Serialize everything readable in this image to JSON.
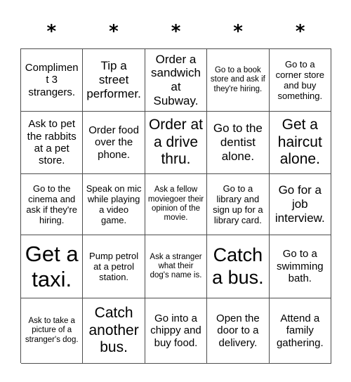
{
  "card": {
    "title": "Bingo Card",
    "columns": 5,
    "rows": 5,
    "header": {
      "icon": "asterisk-icon",
      "labels": [
        "*",
        "*",
        "*",
        "*",
        "*"
      ]
    },
    "colors": {
      "border": "#4d4d4d",
      "text": "#000000",
      "background": "#ffffff"
    },
    "cells": [
      {
        "text": "Compliment 3 strangers.",
        "size": "fs-m"
      },
      {
        "text": "Tip a street performer.",
        "size": "fs-l"
      },
      {
        "text": "Order a sandwich at Subway.",
        "size": "fs-l"
      },
      {
        "text": "Go to a book store and ask if they're hiring.",
        "size": "fs-xs"
      },
      {
        "text": "Go to a corner store and buy something.",
        "size": "fs-s"
      },
      {
        "text": "Ask to pet the rabbits at a pet store.",
        "size": "fs-m"
      },
      {
        "text": "Order food over the phone.",
        "size": "fs-m"
      },
      {
        "text": "Order at a drive thru.",
        "size": "fs-xl"
      },
      {
        "text": "Go to the dentist alone.",
        "size": "fs-l"
      },
      {
        "text": "Get a haircut alone.",
        "size": "fs-xl"
      },
      {
        "text": "Go to the cinema and ask if they're hiring.",
        "size": "fs-s"
      },
      {
        "text": "Speak on mic while playing a video game.",
        "size": "fs-s"
      },
      {
        "text": "Ask a fellow moviegoer their opinion of the movie.",
        "size": "fs-xs"
      },
      {
        "text": "Go to a library and sign up for a library card.",
        "size": "fs-s"
      },
      {
        "text": "Go for a job interview.",
        "size": "fs-l"
      },
      {
        "text": "Get a taxi.",
        "size": "fs-huge"
      },
      {
        "text": "Pump petrol at a petrol station.",
        "size": "fs-s"
      },
      {
        "text": "Ask a stranger what their dog's name is.",
        "size": "fs-xs"
      },
      {
        "text": "Catch a bus.",
        "size": "fs-xxl"
      },
      {
        "text": "Go to a swimming bath.",
        "size": "fs-m"
      },
      {
        "text": "Ask to take a picture of a stranger's dog.",
        "size": "fs-xs"
      },
      {
        "text": "Catch another bus.",
        "size": "fs-xl"
      },
      {
        "text": "Go into a chippy and buy food.",
        "size": "fs-m"
      },
      {
        "text": "Open the door to a delivery.",
        "size": "fs-m"
      },
      {
        "text": "Attend a family gathering.",
        "size": "fs-m"
      }
    ]
  }
}
